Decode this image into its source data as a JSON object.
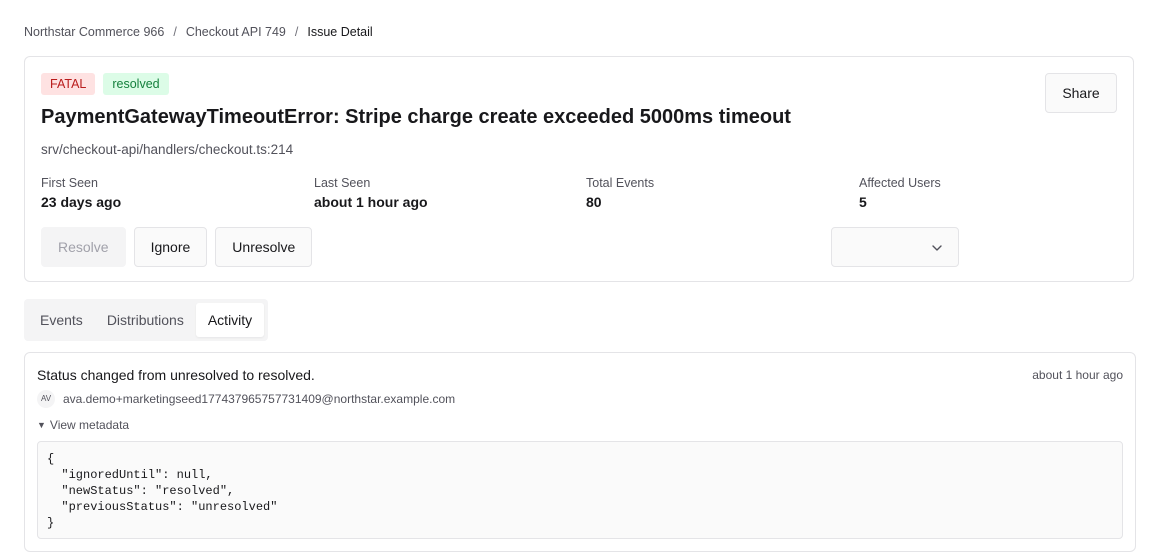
{
  "breadcrumb": {
    "items": [
      "Northstar Commerce 966",
      "Checkout API 749"
    ],
    "separator": "/",
    "current": "Issue Detail"
  },
  "issue": {
    "level_badge": "FATAL",
    "status_badge": "resolved",
    "title": "PaymentGatewayTimeoutError: Stripe charge create exceeded 5000ms timeout",
    "location": "srv/checkout-api/handlers/checkout.ts:214",
    "share_label": "Share",
    "stats": [
      {
        "label": "First Seen",
        "value": "23 days ago"
      },
      {
        "label": "Last Seen",
        "value": "about 1 hour ago"
      },
      {
        "label": "Total Events",
        "value": "80"
      },
      {
        "label": "Affected Users",
        "value": "5"
      }
    ],
    "actions": {
      "resolve": "Resolve",
      "ignore": "Ignore",
      "unresolve": "Unresolve"
    },
    "assignee_select": {
      "value": "",
      "icon": "chevron-down-icon"
    }
  },
  "tabs": [
    {
      "label": "Events",
      "active": false
    },
    {
      "label": "Distributions",
      "active": false
    },
    {
      "label": "Activity",
      "active": true
    }
  ],
  "activity": {
    "message": "Status changed from unresolved to resolved.",
    "time": "about 1 hour ago",
    "avatar_initials": "AV",
    "user_email": "ava.demo+marketingseed177437965757731409@northstar.example.com",
    "metadata_toggle": "View metadata",
    "metadata_code": "{\n  \"ignoredUntil\": null,\n  \"newStatus\": \"resolved\",\n  \"previousStatus\": \"unresolved\"\n}"
  },
  "colors": {
    "fatal_bg": "#fee2e2",
    "fatal_text": "#b91c1c",
    "resolved_bg": "#dcfce7",
    "resolved_text": "#15803d",
    "border": "#e4e4e7"
  }
}
